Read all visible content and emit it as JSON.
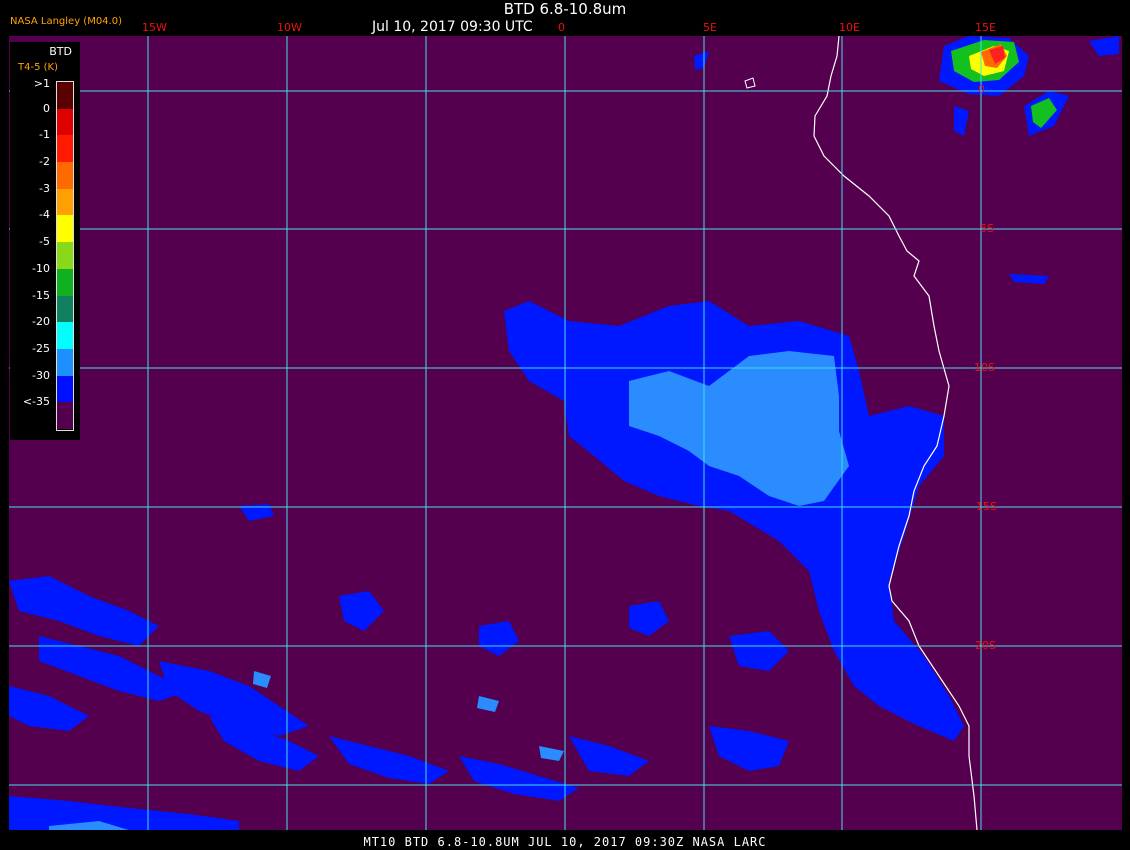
{
  "header": {
    "title": "BTD 6.8-10.8um",
    "datetime": "Jul 10, 2017 09:30 UTC",
    "org": "NASA Langley (M04.0)"
  },
  "footer": {
    "text": "MT10  BTD 6.8-10.8UM  JUL 10, 2017 09:30Z  NASA LARC"
  },
  "grid": {
    "lon_labels": [
      "15W",
      "10W",
      "0",
      "5E",
      "10E",
      "15E"
    ],
    "lat_labels": [
      "0",
      "5S",
      "10S",
      "15S",
      "20S"
    ],
    "line_color": "#40e0e8"
  },
  "legend": {
    "title": "BTD",
    "units": "T4-5 (K)",
    "bins": [
      {
        "label": ">1",
        "color": "#5a0000"
      },
      {
        "label": "0",
        "color": "#e00000"
      },
      {
        "label": "-1",
        "color": "#ff1a00"
      },
      {
        "label": "-2",
        "color": "#ff6a00"
      },
      {
        "label": "-3",
        "color": "#ffa000"
      },
      {
        "label": "-4",
        "color": "#ffff00"
      },
      {
        "label": "-5",
        "color": "#8ad81a"
      },
      {
        "label": "-10",
        "color": "#10b020"
      },
      {
        "label": "-15",
        "color": "#108060"
      },
      {
        "label": "-20",
        "color": "#00ffff"
      },
      {
        "label": "-25",
        "color": "#1e8fff"
      },
      {
        "label": "-30",
        "color": "#0010ff"
      },
      {
        "label": "<-35",
        "color": "#54004e"
      }
    ]
  },
  "colors": {
    "background": "#54004e",
    "cloud_dark": "#0018ff",
    "cloud_light": "#2a8cff",
    "coastline": "#ffffff",
    "convection_green": "#14c020",
    "convection_red": "#ff2020"
  }
}
